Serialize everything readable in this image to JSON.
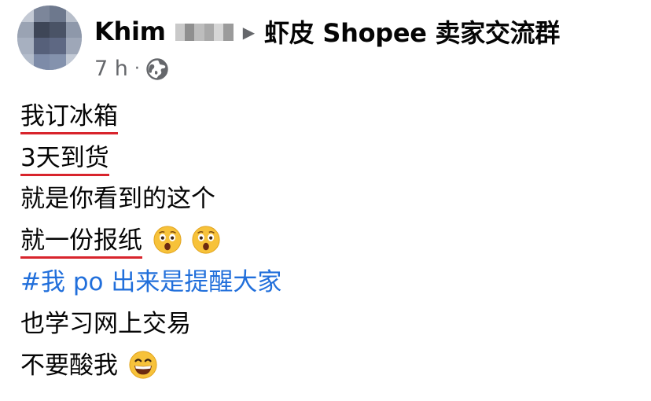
{
  "post": {
    "author": "Khim",
    "group": "虾皮 Shopee 卖家交流群",
    "time": "7 h",
    "separator": "·",
    "arrow": "▶",
    "privacy_icon": "globe-icon",
    "lines": [
      {
        "text": "我订冰箱",
        "underlined": true
      },
      {
        "text": "3天到货",
        "underlined": true
      },
      {
        "text": "就是你看到的这个",
        "underlined": false
      },
      {
        "text": "就一份报纸",
        "underlined": true,
        "emojis": [
          "astonished-face-icon",
          "astonished-face-icon"
        ]
      },
      {
        "text": "#我 po 出来是提醒大家",
        "hashtag": true
      },
      {
        "text": "也学习网上交易"
      },
      {
        "text": "不要酸我",
        "emojis": [
          "grinning-face-icon"
        ]
      }
    ]
  },
  "colors": {
    "text": "#050505",
    "secondary": "#65676b",
    "hashtag": "#216fdb",
    "underline": "#d8242c",
    "emoji_yellow": "#f7c23a"
  }
}
